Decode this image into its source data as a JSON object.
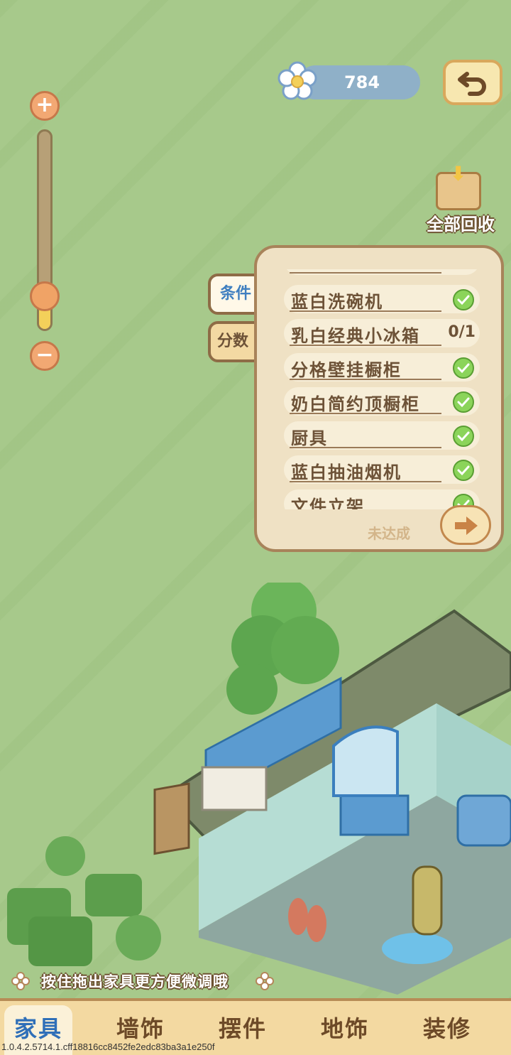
{
  "currency": {
    "value": "784",
    "icon": "flower-icon"
  },
  "zoom": {
    "level": 0.15,
    "plus_icon": "plus-icon",
    "minus_icon": "minus-icon"
  },
  "recycle": {
    "label": "全部回收",
    "icon": "box-arrow-icon"
  },
  "side_tabs": [
    {
      "label": "条件",
      "active": true
    },
    {
      "label": "分数",
      "active": false
    }
  ],
  "tasks": [
    {
      "name": "蓝白洗碗机",
      "done": true,
      "progress": ""
    },
    {
      "name": "乳白经典小冰箱",
      "done": false,
      "progress": "0/1"
    },
    {
      "name": "分格壁挂橱柜",
      "done": true,
      "progress": ""
    },
    {
      "name": "奶白简约顶橱柜",
      "done": true,
      "progress": ""
    },
    {
      "name": "厨具",
      "done": true,
      "progress": ""
    },
    {
      "name": "蓝白抽油烟机",
      "done": true,
      "progress": ""
    },
    {
      "name": "文件立架",
      "done": true,
      "progress": ""
    }
  ],
  "panel": {
    "status": "未达成"
  },
  "tip": {
    "text": "按住拖出家具更方便微调哦"
  },
  "bottom_tabs": [
    {
      "label": "家具",
      "active": true
    },
    {
      "label": "墙饰",
      "active": false
    },
    {
      "label": "摆件",
      "active": false
    },
    {
      "label": "地饰",
      "active": false
    },
    {
      "label": "装修",
      "active": false
    }
  ],
  "version": "1.0.4.2.5714.1.cff18816cc8452fe2edc83ba3a1e250f",
  "colors": {
    "background": "#a7c98b",
    "accent_blue": "#2f6fb8",
    "check_green": "#8bd45a"
  }
}
